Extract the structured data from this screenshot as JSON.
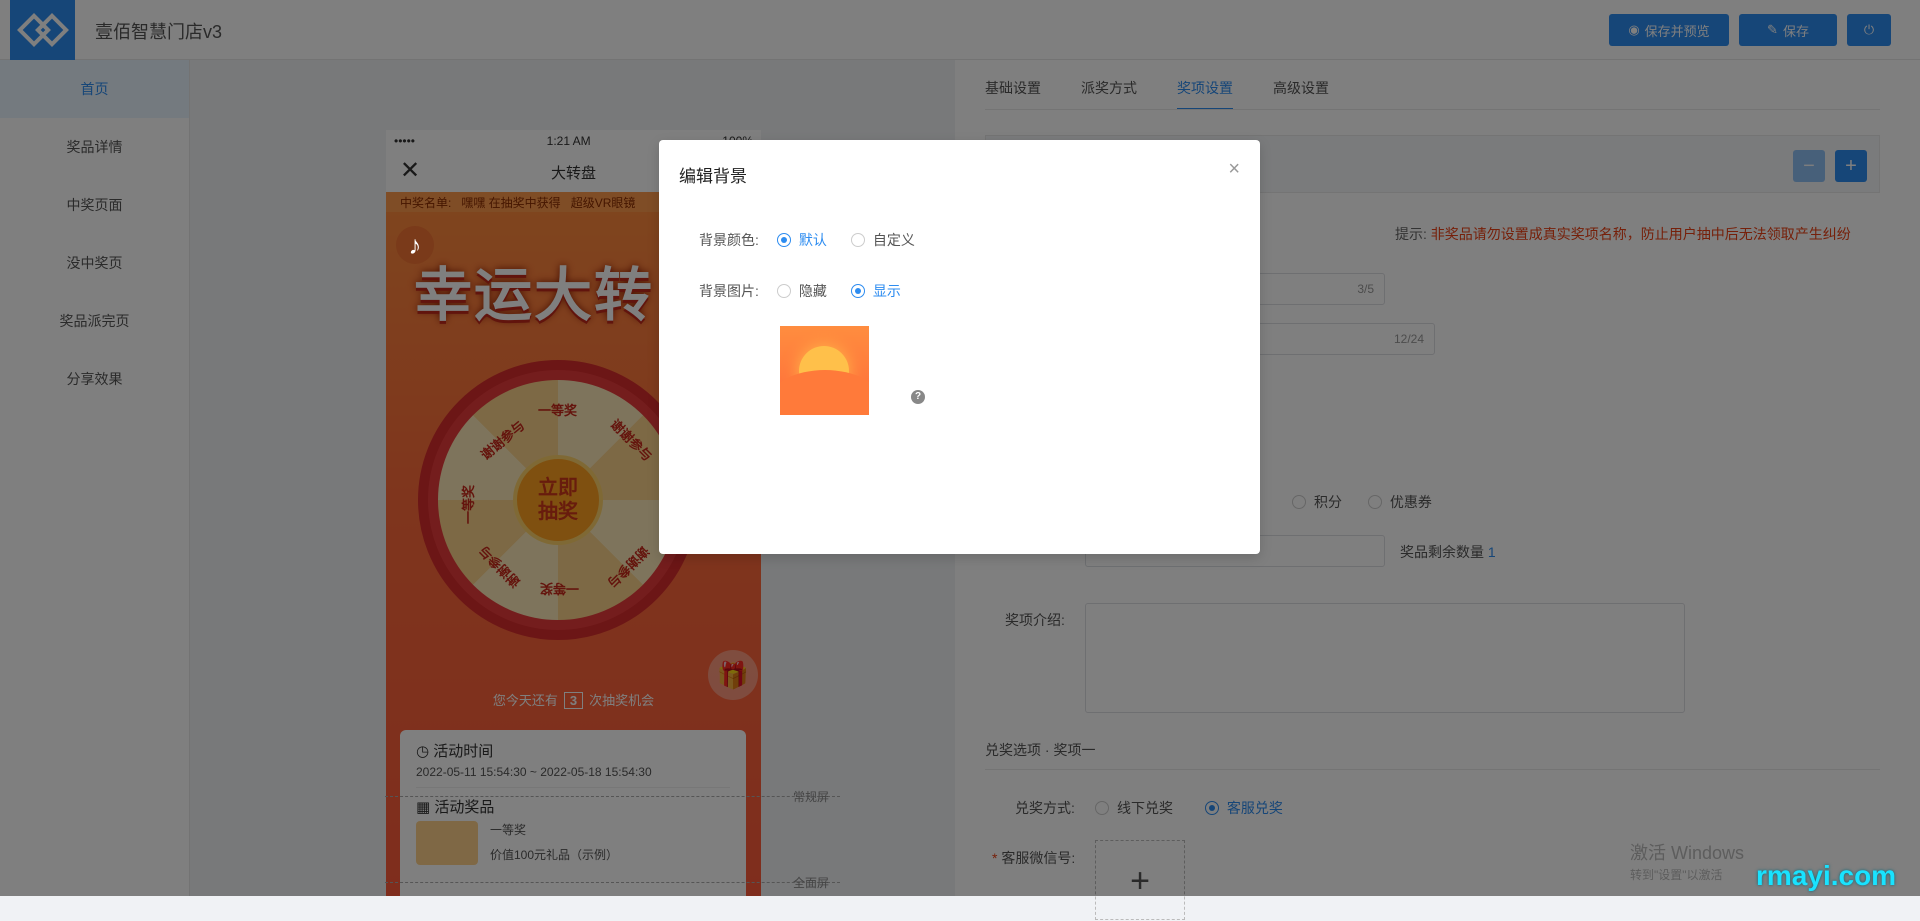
{
  "header": {
    "app_title": "壹佰智慧门店v3",
    "buttons": {
      "save_preview": "保存并预览",
      "save": "保存"
    }
  },
  "sidebar": {
    "items": [
      {
        "label": "首页",
        "active": true
      },
      {
        "label": "奖品详情"
      },
      {
        "label": "中奖页面"
      },
      {
        "label": "没中奖页"
      },
      {
        "label": "奖品派完页"
      },
      {
        "label": "分享效果"
      }
    ]
  },
  "preview": {
    "status": {
      "signal": "•••••",
      "time": "1:21 AM",
      "battery": "100%"
    },
    "nav_title": "大转盘",
    "ticker": {
      "prefix": "中奖名单:",
      "text": "嘿嘿 在抽奖中获得",
      "text2": "超级VR眼镜"
    },
    "hero_title": "幸运大转",
    "wheel": {
      "hub_line1": "立即",
      "hub_line2": "抽奖",
      "labels": [
        "一等奖",
        "谢谢参与",
        "谢谢参与",
        "一等奖",
        "谢谢参与",
        "一等奖",
        "谢谢参与"
      ]
    },
    "chance": {
      "prefix": "您今天还有",
      "count": "3",
      "suffix": "次抽奖机会"
    },
    "activity_time": {
      "title": "活动时间",
      "value": "2022-05-11 15:54:30 ~ 2022-05-18 15:54:30"
    },
    "activity_prize": {
      "title": "活动奖品",
      "name": "一等奖",
      "desc": "价值100元礼品（示例）"
    },
    "screen_labels": {
      "normal": "常规屏",
      "full": "全面屏"
    }
  },
  "panel": {
    "tabs": [
      {
        "label": "基础设置"
      },
      {
        "label": "派奖方式"
      },
      {
        "label": "奖项设置",
        "active": true
      },
      {
        "label": "高级设置"
      }
    ],
    "hint": {
      "prefix": "提示:",
      "text": "非奖品请勿设置成真实奖项名称，防止用户抽中后无法领取产生纠纷"
    },
    "counters": {
      "name": "3/5",
      "desc": "12/24"
    },
    "prize_type": {
      "options": [
        "积分",
        "优惠券"
      ]
    },
    "remain": {
      "label": "奖品剩余数量",
      "value": "1"
    },
    "intro_label": "奖项介绍:",
    "redeem_section": "兑奖选项 · 奖项一",
    "redeem": {
      "label": "兑奖方式:",
      "options": [
        "线下兑奖",
        "客服兑奖"
      ],
      "selected": "客服兑奖"
    },
    "wechat_label": "客服微信号:",
    "upload_symbol": "+"
  },
  "watermark": {
    "line1": "激活 Windows",
    "line2": "转到\"设置\"以激活",
    "site": "rmayi.com"
  },
  "modal": {
    "title": "编辑背景",
    "close": "×",
    "bg_color": {
      "label": "背景颜色:",
      "options": [
        "默认",
        "自定义"
      ],
      "selected": "默认"
    },
    "bg_image": {
      "label": "背景图片:",
      "options": [
        "隐藏",
        "显示"
      ],
      "selected": "显示"
    },
    "help": "?"
  },
  "colors": {
    "accent": "#2d8cf0",
    "danger": "#ed4014",
    "overlay": "rgba(0,0,0,0.5)"
  }
}
